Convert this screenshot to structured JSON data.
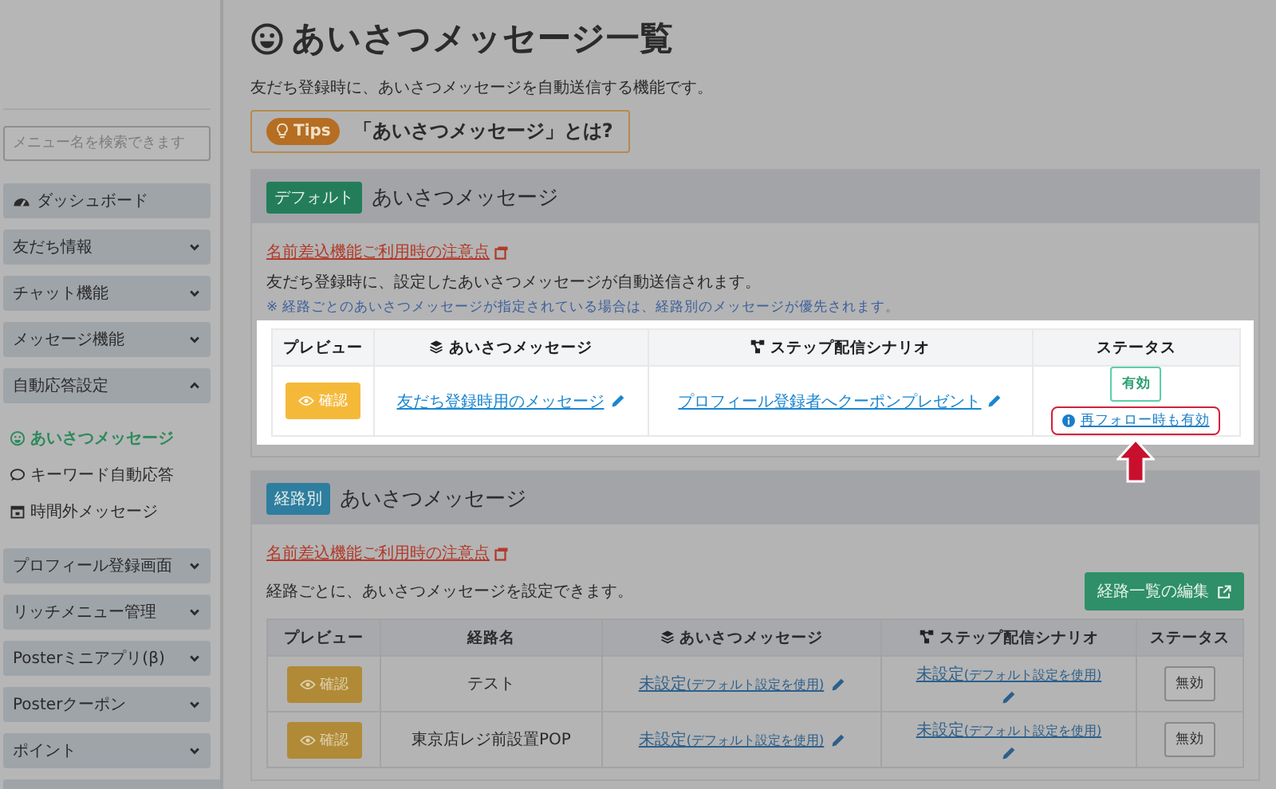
{
  "sidebar": {
    "search": {
      "placeholder": "メニュー名を検索できます"
    },
    "items": [
      {
        "kind": "plain",
        "label": "ダッシュボード"
      },
      {
        "kind": "menu",
        "label": "友だち情報",
        "expanded": false
      },
      {
        "kind": "menu",
        "label": "チャット機能",
        "expanded": false
      },
      {
        "kind": "menu",
        "label": "メッセージ機能",
        "expanded": false
      },
      {
        "kind": "menu",
        "label": "自動応答設定",
        "expanded": true,
        "children": [
          {
            "label": "あいさつメッセージ",
            "selected": true
          },
          {
            "label": "キーワード自動応答",
            "selected": false
          },
          {
            "label": "時間外メッセージ",
            "selected": false
          }
        ]
      },
      {
        "kind": "menu",
        "label": "プロフィール登録画面",
        "expanded": false
      },
      {
        "kind": "menu",
        "label": "リッチメニュー管理",
        "expanded": false
      },
      {
        "kind": "menu",
        "label": "Posterミニアプリ(β)",
        "expanded": false
      },
      {
        "kind": "menu",
        "label": "Posterクーポン",
        "expanded": false
      },
      {
        "kind": "menu",
        "label": "ポイント",
        "expanded": false
      }
    ]
  },
  "page": {
    "title": "あいさつメッセージ一覧",
    "description": "友だち登録時に、あいさつメッセージを自動送信する機能です。",
    "tips": {
      "badge": "Tips",
      "text": "「あいさつメッセージ」とは?"
    }
  },
  "default_section": {
    "badge": "デフォルト",
    "title": "あいさつメッセージ",
    "notice_link": "名前差込機能ご利用時の注意点",
    "description": "友だち登録時に、設定したあいさつメッセージが自動送信されます。",
    "note": "※ 経路ごとのあいさつメッセージが指定されている場合は、経路別のメッセージが優先されます。",
    "table": {
      "highlighted": true,
      "columns": [
        {
          "kind": "plain",
          "label": "プレビュー"
        },
        {
          "kind": "message",
          "label": "あいさつメッセージ"
        },
        {
          "kind": "scenario",
          "label": "ステップ配信シナリオ"
        },
        {
          "kind": "plain",
          "label": "ステータス"
        }
      ],
      "rows": [
        {
          "preview": "確認",
          "message": "友だち登録時用のメッセージ",
          "scenario": "プロフィール登録者へクーポンプレゼント",
          "status": "有効",
          "active": true,
          "refollow": "再フォロー時も有効"
        }
      ]
    }
  },
  "route_section": {
    "badge": "経路別",
    "title": "あいさつメッセージ",
    "notice_link": "名前差込機能ご利用時の注意点",
    "description": "経路ごとに、あいさつメッセージを設定できます。",
    "edit_button": "経路一覧の編集",
    "table": {
      "highlighted": false,
      "columns": [
        {
          "kind": "plain",
          "label": "プレビュー"
        },
        {
          "kind": "plain",
          "label": "経路名"
        },
        {
          "kind": "message",
          "label": "あいさつメッセージ"
        },
        {
          "kind": "scenario",
          "label": "ステップ配信シナリオ"
        },
        {
          "kind": "plain",
          "label": "ステータス"
        }
      ],
      "rows": [
        {
          "preview": "確認",
          "route": "テスト",
          "message": "未設定",
          "message_note": "(デフォルト設定を使用)",
          "scenario": "未設定",
          "scenario_note": "(デフォルト設定を使用)",
          "status": "無効",
          "active": false
        },
        {
          "preview": "確認",
          "route": "東京店レジ前設置POP",
          "message": "未設定",
          "message_note": "(デフォルト設定を使用)",
          "scenario": "未設定",
          "scenario_note": "(デフォルト設定を使用)",
          "status": "無効",
          "active": false
        }
      ]
    }
  }
}
